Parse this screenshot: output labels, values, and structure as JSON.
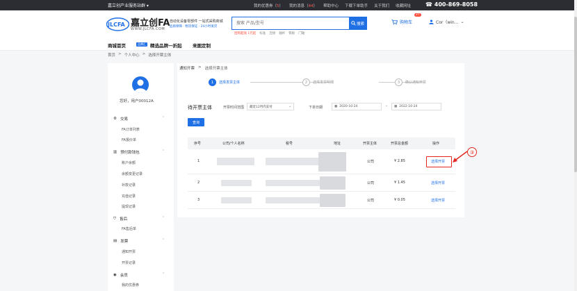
{
  "topbar": {
    "city_label": "嘉立创产业服务站群",
    "links": [
      {
        "label": "我的优惠券",
        "count": "5"
      },
      {
        "label": "我的消息",
        "count": "44"
      },
      {
        "label": "帮助中心"
      },
      {
        "label": "下载下单助手"
      },
      {
        "label": "关于我们"
      },
      {
        "label": "收藏网址"
      }
    ],
    "phone": "400-869-8058"
  },
  "header": {
    "logo_text": "嘉立创FA",
    "logo_badge": "JLCFA",
    "logo_url": "WWW.JLCFA.COM",
    "slogan": "自动化设备零部件 一站式采购商城",
    "slogan_sub": "品质保障 · 物流保证 · 24小时发货",
    "search_placeholder": "搜索 产品/型号",
    "search_button": "搜索",
    "hot_words": [
      "团购超值 1元起",
      "标准",
      "连接",
      "轴杆",
      "铁板",
      "门轴"
    ],
    "cart_label": "购物车",
    "cart_count": "27",
    "user_label": "Cor（win..."
  },
  "nav": {
    "items": [
      "商城首页",
      "精选品牌一折起",
      "来图定制"
    ],
    "badge": "品牌汇"
  },
  "breadcrumb": [
    "首页",
    "个人中心",
    "选择开票主体"
  ],
  "sidebar": {
    "welcome": "您好，用户00012A",
    "sections": [
      {
        "title": "交易",
        "icon": "gear-icon",
        "items": [
          "FA订单列表",
          "FA报价单"
        ]
      },
      {
        "title": "预付款钱包",
        "icon": "wallet-icon",
        "items": [
          "账户余额",
          "余额变更记录",
          "补款记录",
          "充值记录",
          "提现记录"
        ]
      },
      {
        "title": "售后",
        "icon": "shield-icon",
        "items": [
          "FA售后单"
        ]
      },
      {
        "title": "发票",
        "icon": "invoice-icon",
        "items": [
          "通知开票",
          "开票记录"
        ]
      },
      {
        "title": "会员",
        "icon": "member-icon",
        "items": [
          "我的优惠券"
        ]
      }
    ]
  },
  "main": {
    "breadcrumb": [
      "通知开票",
      "选择开票主体"
    ],
    "steps": [
      {
        "num": "1",
        "label": "选择发票主体"
      },
      {
        "num": "2",
        "label": "选择发票明细"
      },
      {
        "num": "3",
        "label": "确认通知开票"
      }
    ],
    "filter": {
      "title": "待开票主体",
      "time_range_label": "开票时间范围",
      "time_range_value": "最近12月内支付",
      "order_date_label": "下单日期",
      "date_from": "2020-10-24",
      "date_to": "2022-10-24",
      "date_separator": "-",
      "query_button": "查询"
    },
    "table": {
      "headers": [
        "序号",
        "公司/个人名称",
        "税号",
        "地址",
        "开票主体",
        "开票总金额",
        "操作"
      ],
      "rows": [
        {
          "index": "1",
          "type": "公司",
          "amount": "¥ 2.85",
          "action": "选择开票"
        },
        {
          "index": "2",
          "type": "公司",
          "amount": "¥ 1.45",
          "action": "选择开票"
        },
        {
          "index": "3",
          "type": "公司",
          "amount": "¥ 0.05",
          "action": "选择开票"
        }
      ]
    }
  },
  "annotation": {
    "number": "③"
  },
  "colors": {
    "accent": "#1f6fe5",
    "topbar": "#2b2d33",
    "highlight": "#e32620"
  }
}
